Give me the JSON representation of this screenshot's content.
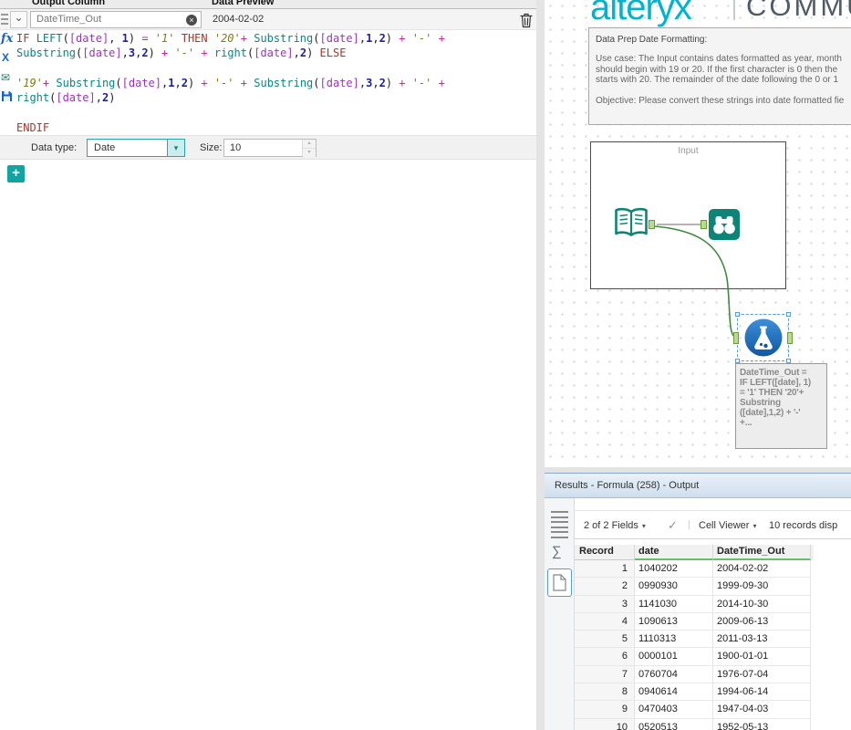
{
  "colors": {
    "accent_teal": "#12a3a3",
    "tool_teal": "#0e8476",
    "formula_tool_blue": "#1a6ab8",
    "connection_green": "#3d8b3d",
    "logo_teal": "#00b3cf",
    "selection_blue": "#5b9bd5",
    "header_green_underline": "#66bf6a"
  },
  "formula_panel": {
    "columns_header": {
      "output_column": "Output Column",
      "data_preview": "Data Preview"
    },
    "expression": {
      "output_name": "DateTime_Out",
      "preview_value": "2004-02-02"
    },
    "editor_lines": [
      [
        [
          "kw",
          "IF"
        ],
        [
          "pl",
          " "
        ],
        [
          "fn",
          "LEFT"
        ],
        [
          "pl",
          "("
        ],
        [
          "fld",
          "[date]"
        ],
        [
          "pl",
          ", "
        ],
        [
          "num",
          "1"
        ],
        [
          "pl",
          ") "
        ],
        [
          "op",
          "="
        ],
        [
          "pl",
          " "
        ],
        [
          "str",
          "'1'"
        ],
        [
          "pl",
          " "
        ],
        [
          "kw",
          "THEN"
        ],
        [
          "pl",
          " "
        ],
        [
          "str",
          "'20'"
        ],
        [
          "op",
          "+"
        ],
        [
          "pl",
          " "
        ],
        [
          "fn",
          "Substring"
        ],
        [
          "pl",
          "("
        ],
        [
          "fld",
          "[date]"
        ],
        [
          "pl",
          ","
        ],
        [
          "num",
          "1"
        ],
        [
          "pl",
          ","
        ],
        [
          "num",
          "2"
        ],
        [
          "pl",
          ") "
        ],
        [
          "op",
          "+"
        ],
        [
          "pl",
          " "
        ],
        [
          "str",
          "'-'"
        ],
        [
          "pl",
          " "
        ],
        [
          "op",
          "+"
        ]
      ],
      [
        [
          "fn",
          "Substring"
        ],
        [
          "pl",
          "("
        ],
        [
          "fld",
          "[date]"
        ],
        [
          "pl",
          ","
        ],
        [
          "num",
          "3"
        ],
        [
          "pl",
          ","
        ],
        [
          "num",
          "2"
        ],
        [
          "pl",
          ") "
        ],
        [
          "op",
          "+"
        ],
        [
          "pl",
          " "
        ],
        [
          "str",
          "'-'"
        ],
        [
          "pl",
          " "
        ],
        [
          "op",
          "+"
        ],
        [
          "pl",
          " "
        ],
        [
          "fn",
          "right"
        ],
        [
          "pl",
          "("
        ],
        [
          "fld",
          "[date]"
        ],
        [
          "pl",
          ","
        ],
        [
          "num",
          "2"
        ],
        [
          "pl",
          ") "
        ],
        [
          "kw",
          "ELSE"
        ]
      ],
      [],
      [
        [
          "str",
          "'19'"
        ],
        [
          "op",
          "+"
        ],
        [
          "pl",
          " "
        ],
        [
          "fn",
          "Substring"
        ],
        [
          "pl",
          "("
        ],
        [
          "fld",
          "[date]"
        ],
        [
          "pl",
          ","
        ],
        [
          "num",
          "1"
        ],
        [
          "pl",
          ","
        ],
        [
          "num",
          "2"
        ],
        [
          "pl",
          ") "
        ],
        [
          "op",
          "+"
        ],
        [
          "pl",
          " "
        ],
        [
          "str",
          "'-'"
        ],
        [
          "pl",
          " "
        ],
        [
          "op",
          "+"
        ],
        [
          "pl",
          " "
        ],
        [
          "fn",
          "Substring"
        ],
        [
          "pl",
          "("
        ],
        [
          "fld",
          "[date]"
        ],
        [
          "pl",
          ","
        ],
        [
          "num",
          "3"
        ],
        [
          "pl",
          ","
        ],
        [
          "num",
          "2"
        ],
        [
          "pl",
          ") "
        ],
        [
          "op",
          "+"
        ],
        [
          "pl",
          " "
        ],
        [
          "str",
          "'-'"
        ],
        [
          "pl",
          " "
        ],
        [
          "op",
          "+"
        ]
      ],
      [
        [
          "fn",
          "right"
        ],
        [
          "pl",
          "("
        ],
        [
          "fld",
          "[date]"
        ],
        [
          "pl",
          ","
        ],
        [
          "num",
          "2"
        ],
        [
          "pl",
          ")"
        ]
      ],
      [],
      [
        [
          "kw",
          "ENDIF"
        ]
      ]
    ],
    "data_type_label": "Data type:",
    "data_type_value": "Date",
    "size_label": "Size:",
    "size_value": "10"
  },
  "icons": {
    "chevron_down": "⌄",
    "clear": "×",
    "caret_down": "▾",
    "spin_up": "▴",
    "spin_down": "▾",
    "plus": "+",
    "fx": "fx",
    "insert_column": "X",
    "saved_expressions": "✉",
    "sigma": "∑",
    "check": "✓",
    "separator": "|"
  },
  "canvas": {
    "logo_text": "alteryx",
    "logo_suffix": "COMMUN",
    "comment": {
      "title": "Data Prep Date Formatting:",
      "body": [
        "Use case: The Input contains dates formatted as year, month",
        "should begin with 19 or 20.  If the first character is 0 then the",
        "starts with 20.  The remainder of the date following the 0 or 1",
        "",
        "Objective: Please convert these strings into date formatted fie"
      ]
    },
    "container_label": "Input",
    "annotation": [
      "DateTime_Out =",
      "IF LEFT([date], 1)",
      "= '1' THEN '20'+",
      "Substring",
      "([date],1,2) + '-'",
      "+..."
    ]
  },
  "results": {
    "title": "Results - Formula (258) - Output",
    "toolbar": {
      "fields": "2 of 2 Fields",
      "cell_viewer": "Cell Viewer",
      "records": "10 records disp"
    },
    "table": {
      "columns": [
        "Record",
        "date",
        "DateTime_Out"
      ],
      "rows": [
        [
          "1",
          "1040202",
          "2004-02-02"
        ],
        [
          "2",
          "0990930",
          "1999-09-30"
        ],
        [
          "3",
          "1141030",
          "2014-10-30"
        ],
        [
          "4",
          "1090613",
          "2009-06-13"
        ],
        [
          "5",
          "1110313",
          "2011-03-13"
        ],
        [
          "6",
          "0000101",
          "1900-01-01"
        ],
        [
          "7",
          "0760704",
          "1976-07-04"
        ],
        [
          "8",
          "0940614",
          "1994-06-14"
        ],
        [
          "9",
          "0470403",
          "1947-04-03"
        ],
        [
          "10",
          "0520513",
          "1952-05-13"
        ]
      ]
    }
  }
}
